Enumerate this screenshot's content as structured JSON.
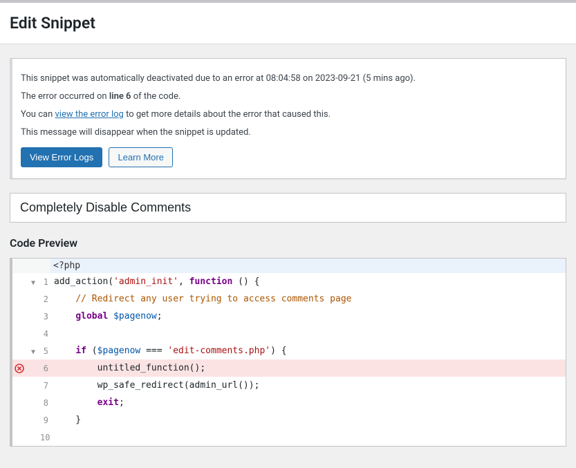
{
  "header": {
    "page_title": "Edit Snippet"
  },
  "notice": {
    "line1_prefix": "This snippet was automatically deactivated due to an error at ",
    "error_time": "08:04:58",
    "line1_mid": " on ",
    "error_date": "2023-09-21",
    "line1_suffix": " (5 mins ago).",
    "line2_prefix": "The error occurred on ",
    "line2_bold": "line 6",
    "line2_suffix": " of the code.",
    "line3_prefix": "You can ",
    "line3_link": "view the error log",
    "line3_suffix": " to get more details about the error that caused this.",
    "line4": "This message will disappear when the snippet is updated.",
    "btn_primary": "View Error Logs",
    "btn_secondary": "Learn More"
  },
  "snippet": {
    "title": "Completely Disable Comments"
  },
  "code_section": {
    "heading": "Code Preview"
  },
  "code": {
    "opening": "<?php",
    "lines": [
      "add_action('admin_init', function () {",
      "    // Redirect any user trying to access comments page",
      "    global $pagenow;",
      "",
      "    if ($pagenow === 'edit-comments.php') {",
      "        untitled_function();",
      "        wp_safe_redirect(admin_url());",
      "        exit;",
      "    }",
      ""
    ],
    "error_line": 6,
    "fold_lines": [
      1,
      5
    ]
  }
}
